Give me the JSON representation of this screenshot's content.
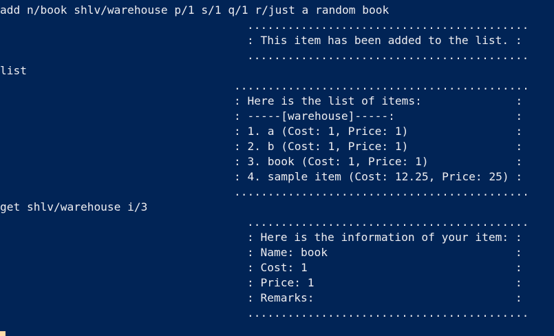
{
  "terminal": {
    "background": "#012456",
    "foreground": "#eeedf0",
    "cursor_color": "#fedba9"
  },
  "commands": {
    "add": "add n/book shlv/warehouse p/1 s/1 q/1 r/just a random book",
    "list": "list",
    "get": "get shlv/warehouse i/3"
  },
  "add_output": {
    "border_top": "..........................................",
    "message": ": This item has been added to the list. :",
    "border_bottom": ".........................................."
  },
  "list_output": {
    "border_top": "............................................",
    "header": ": Here is the list of items:              :",
    "shelf": ": -----[warehouse]-----:                  :",
    "items": [
      ": 1. a (Cost: 1, Price: 1)                :",
      ": 2. b (Cost: 1, Price: 1)                :",
      ": 3. book (Cost: 1, Price: 1)             :",
      ": 4. sample item (Cost: 12.25, Price: 25) :"
    ],
    "border_bottom": "............................................"
  },
  "get_output": {
    "border_top": "..........................................",
    "header": ": Here is the information of your item: :",
    "name": ": Name: book                            :",
    "cost": ": Cost: 1                               :",
    "price": ": Price: 1                              :",
    "remarks": ": Remarks:                              :",
    "border_bottom": ".........................................."
  }
}
